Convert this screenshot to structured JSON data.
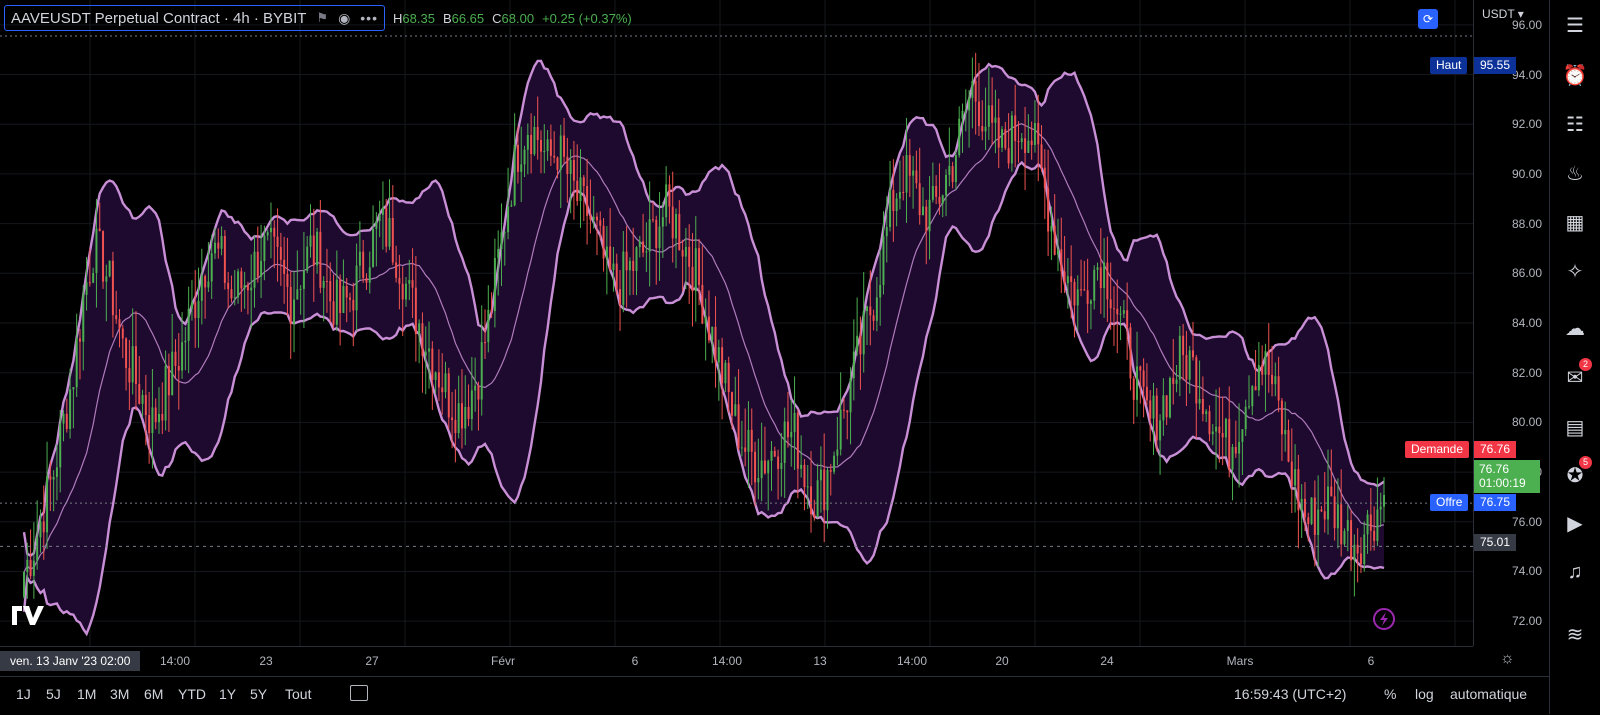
{
  "symbol": {
    "title": "AAVEUSDT Perpetual Contract · 4h · BYBIT",
    "h_label": "H",
    "h_value": "68.35",
    "b_label": "B",
    "b_value": "66.65",
    "c_label": "C",
    "c_value": "68.00",
    "change": "+0.25 (+0.37%)"
  },
  "currency": "USDT",
  "colors": {
    "up": "#4caf50",
    "down": "#f05350",
    "band": "#c98fd6",
    "band_fill": "#1e0a2e",
    "accent": "#2962ff"
  },
  "price_tags": {
    "haut_label": "Haut",
    "haut_value": "95.55",
    "demande_label": "Demande",
    "demande_value": "76.76",
    "last_value": "76.76",
    "countdown": "01:00:19",
    "offre_label": "Offre",
    "offre_value": "76.75",
    "crosshair_value": "75.01"
  },
  "time_axis": {
    "cursor": "ven. 13 Janv '23    02:00",
    "labels": [
      "14:00",
      "23",
      "27",
      "Févr",
      "6",
      "14:00",
      "13",
      "14:00",
      "20",
      "24",
      "Mars",
      "6"
    ]
  },
  "bottom": {
    "timeframes": [
      "1J",
      "5J",
      "1M",
      "3M",
      "6M",
      "YTD",
      "1Y",
      "5Y",
      "Tout"
    ],
    "clock": "16:59:43 (UTC+2)",
    "percent": "%",
    "log": "log",
    "auto": "automatique"
  },
  "sidebar": {
    "icons": [
      "watchlist-icon",
      "alarm-clock-icon",
      "add-list-icon",
      "hotlist-fire-icon",
      "calendar-icon",
      "ideas-bulb-icon",
      "chat-cloud-icon",
      "chats-icon",
      "notes-icon",
      "streams-icon",
      "play-icon",
      "bell-icon",
      "tools-icon"
    ],
    "badges": {
      "chats": "2",
      "streams": "5"
    }
  },
  "chart_data": {
    "type": "candlestick",
    "y_range": [
      71,
      97
    ],
    "yticks": [
      72,
      74,
      76,
      78,
      80,
      82,
      84,
      86,
      88,
      90,
      92,
      94,
      96
    ],
    "ytick_labels": [
      "72.00",
      "74.00",
      "76.00",
      "78.00",
      "80.00",
      "82.00",
      "84.00",
      "86.00",
      "88.00",
      "90.00",
      "92.00",
      "94.00",
      "96.00"
    ],
    "close_trend": [
      74,
      75,
      76.5,
      78,
      80,
      82,
      85,
      87,
      86.5,
      85,
      83,
      82,
      81,
      80,
      81,
      82,
      83,
      84.5,
      86,
      87,
      86.5,
      85,
      85.5,
      86,
      87,
      86.8,
      86,
      85,
      86,
      87,
      86.5,
      85,
      84.5,
      85,
      86,
      87,
      88,
      87.5,
      86.5,
      85,
      84,
      83,
      82,
      81,
      80.5,
      81,
      82,
      84,
      86.5,
      89,
      91,
      92,
      91.5,
      90.5,
      91,
      90,
      89,
      88.5,
      87.5,
      86,
      85.5,
      86,
      86.5,
      87,
      88,
      88.5,
      88,
      87,
      86,
      84.5,
      83,
      81.5,
      80,
      79,
      78.5,
      78.5,
      79,
      79.5,
      79.5,
      78,
      77,
      77.5,
      79,
      80.5,
      82,
      83.5,
      85,
      87,
      89,
      90,
      89.5,
      88.5,
      88.5,
      89.5,
      90.5,
      92,
      93.5,
      92.5,
      91.5,
      91,
      91.5,
      92,
      91.5,
      90,
      88,
      86.5,
      85.5,
      85,
      86,
      86.5,
      85.5,
      84,
      82.5,
      81,
      80,
      80.5,
      81.5,
      82.5,
      82.5,
      81.5,
      80.5,
      79.5,
      79,
      80,
      81.5,
      82.5,
      82,
      80.5,
      78.5,
      77,
      76,
      76.5,
      76.8,
      76.2,
      75.5,
      75.2,
      75.8,
      76.5,
      77.2
    ],
    "high": 95.55,
    "low": 72.9,
    "bollinger_period": 20,
    "bollinger_stddev": 2,
    "grid": true,
    "legend": "top-left"
  }
}
